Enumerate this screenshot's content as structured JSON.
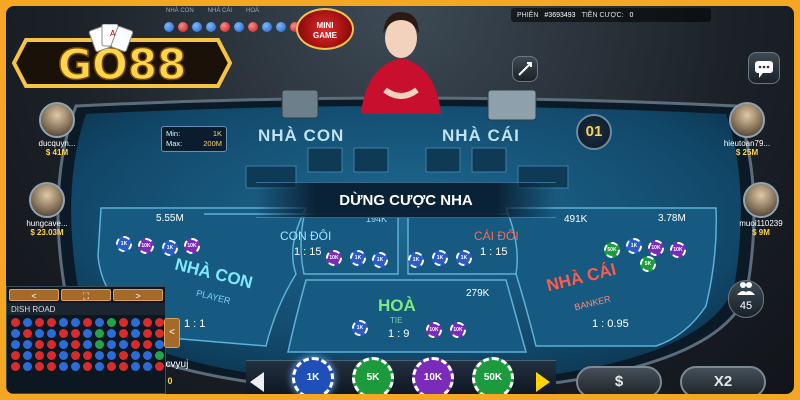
{
  "brand": {
    "logo_text": "GO88"
  },
  "top": {
    "legend_left": [
      "NHÀ CON",
      "NHÀ CÁI",
      "HOÀ"
    ],
    "mini_game": [
      "MINI",
      "GAME"
    ],
    "session_label": "PHIÊN",
    "session_value": "#3693493",
    "bet_label": "TIỀN CƯỢC:",
    "bet_value": "0"
  },
  "table": {
    "player_area_label": "NHÀ CON",
    "banker_area_label": "NHÀ CÁI",
    "min_label": "Min:",
    "min_value": "1K",
    "max_label": "Max:",
    "max_value": "200M",
    "round_number": "01",
    "banner": "DỪNG CƯỢC NHA",
    "bets": {
      "player": {
        "total": "5.55M",
        "title": "NHÀ CON",
        "sub": "PLAYER",
        "odds": "1 : 1"
      },
      "player_pair": {
        "total": "194K",
        "title": "CON ĐÔI",
        "odds": "1 : 15"
      },
      "banker_pair": {
        "total": "491K",
        "title": "CÁI ĐÔI",
        "odds": "1 : 15"
      },
      "banker": {
        "total": "3.78M",
        "title": "NHÀ CÁI",
        "sub": "BANKER",
        "odds": "1 : 0.95"
      },
      "tie": {
        "total": "279K",
        "title": "HOÀ",
        "sub": "TIE",
        "odds": "1 : 9"
      }
    }
  },
  "players": {
    "left": [
      {
        "name": "ducquyn...",
        "money": "$ 41M"
      },
      {
        "name": "hungcave...",
        "money": "$ 23.03M"
      },
      {
        "name": "acvyuj",
        "money": "$ 0"
      }
    ],
    "right": [
      {
        "name": "hieutoan79...",
        "money": "$ 25M"
      },
      {
        "name": "muoi110239",
        "money": "$ 9M"
      }
    ],
    "online_count": "45"
  },
  "road": {
    "title": "DISH ROAD",
    "left_btn": "<",
    "expand_btn": "⛶",
    "right_btn": ">",
    "toggle": "<"
  },
  "chips": {
    "items": [
      "1K",
      "5K",
      "10K",
      "50K"
    ],
    "colors": [
      "#1f4fb8",
      "#1d9a3c",
      "#7a2bb8",
      "#1d9a3c"
    ]
  },
  "actions": {
    "rebet_label": "$",
    "double_label": "X2"
  }
}
